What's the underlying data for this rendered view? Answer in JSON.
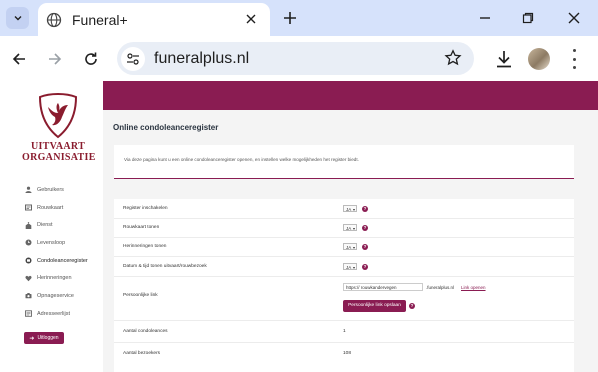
{
  "browser": {
    "tab_title": "Funeral+",
    "url": "funeralplus.nl"
  },
  "logo": {
    "line1": "UITVAART",
    "line2": "ORGANISATIE"
  },
  "sidebar": {
    "items": [
      {
        "label": "Gebruikers",
        "icon": "user-icon"
      },
      {
        "label": "Rouwkaart",
        "icon": "card-icon"
      },
      {
        "label": "Dienst",
        "icon": "church-icon"
      },
      {
        "label": "Levensloop",
        "icon": "clock-icon"
      },
      {
        "label": "Condoleanceregister",
        "icon": "register-icon"
      },
      {
        "label": "Herinneringen",
        "icon": "heart-icon"
      },
      {
        "label": "Opnageservice",
        "icon": "camera-icon"
      },
      {
        "label": "Adresseerlijst",
        "icon": "address-icon"
      }
    ],
    "logout_label": "Uitloggen"
  },
  "page": {
    "title": "Online condoleanceregister",
    "info_text": "Via deze pagina kunt u een online condoleanceregister openen, en instellen welke mogelijkheden het register biedt."
  },
  "form": {
    "rows": [
      {
        "label": "Register inschakelen",
        "value": "JA"
      },
      {
        "label": "Rouwkaart tonen",
        "value": "JA"
      },
      {
        "label": "Herinneringen tonen",
        "value": "JA"
      },
      {
        "label": "Datum & tijd tonen uitvaart/rouwbezoek",
        "value": "JA"
      }
    ],
    "personal_link": {
      "label": "Persoonlijke link",
      "prefix_value": "https:// rouwkandervegen",
      "suffix": ".funeralplus.nl",
      "open_link": "Link openen",
      "save_button": "Persoonlijke link opslaan"
    },
    "condolences": {
      "label": "Aantal condoleances",
      "value": "1"
    },
    "visitors": {
      "label": "Aantal bezoekers",
      "value": "108"
    }
  },
  "colors": {
    "brand": "#8a1c52",
    "logo": "#8a1c2e"
  }
}
